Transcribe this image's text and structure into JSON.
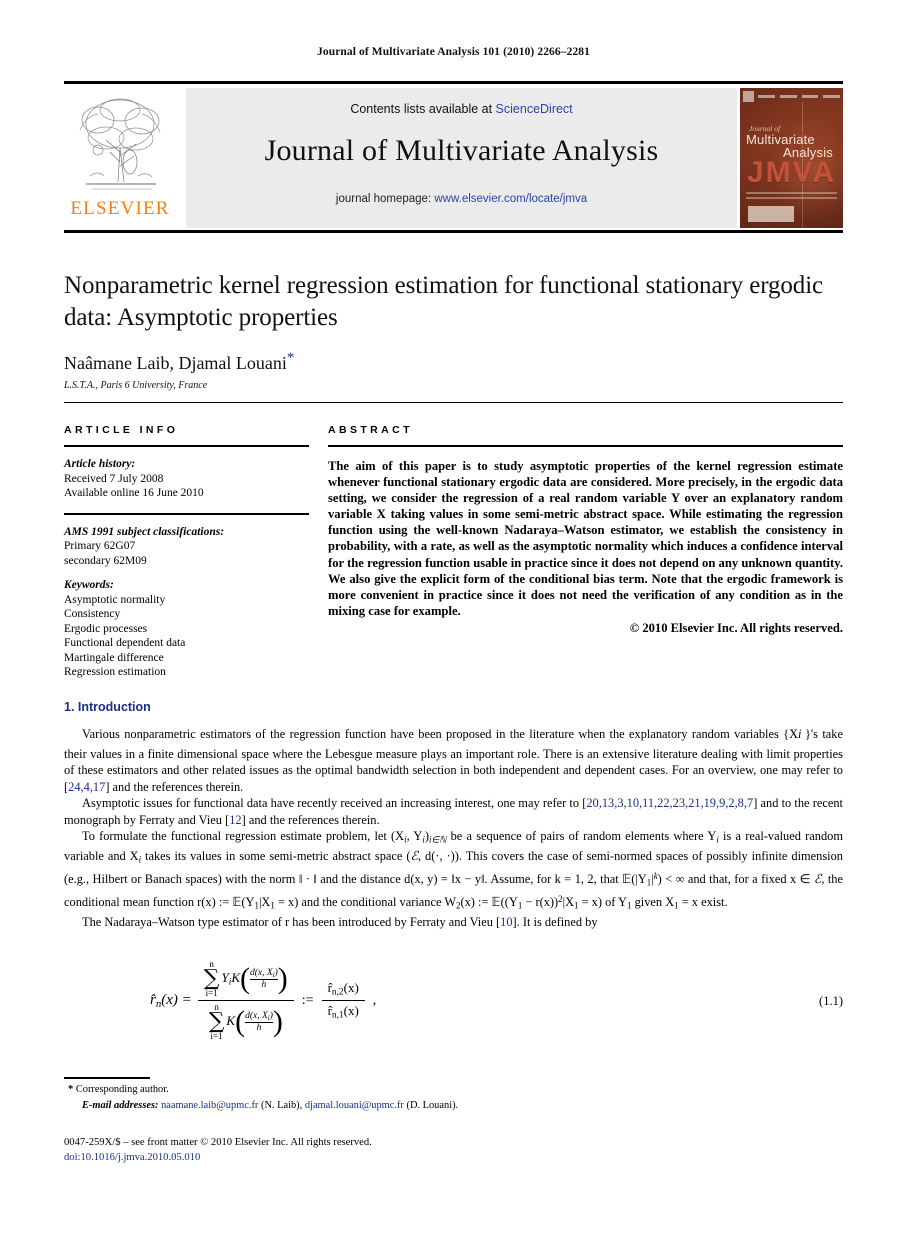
{
  "running_head": "Journal of Multivariate Analysis 101 (2010) 2266–2281",
  "masthead": {
    "contents_prefix": "Contents lists available at ",
    "contents_link": "ScienceDirect",
    "journal_title": "Journal of Multivariate Analysis",
    "homepage_prefix": "journal homepage: ",
    "homepage_url": "www.elsevier.com/locate/jmva",
    "publisher_wordmark": "ELSEVIER",
    "cover": {
      "journal_of": "Journal of",
      "name_line1": "Multivariate",
      "name_line2": "Analysis",
      "acronym": "JMVA"
    },
    "link_color": "#2b44a8",
    "publisher_color": "#F08010",
    "cover_color": "#6d2d1c"
  },
  "article": {
    "title": "Nonparametric kernel regression estimation for functional stationary ergodic data: Asymptotic properties",
    "authors": "Naâmane Laib, Djamal Louani",
    "corresponding_marker": "*",
    "affiliation": "L.S.T.A., Paris 6 University, France"
  },
  "info": {
    "label": "ARTICLE INFO",
    "history_head": "Article history:",
    "history_lines": [
      "Received 7 July 2008",
      "Available online 16 June 2010"
    ],
    "msc_head": "AMS 1991 subject classifications:",
    "msc_lines": [
      "Primary 62G07",
      "secondary 62M09"
    ],
    "keywords_head": "Keywords:",
    "keywords": [
      "Asymptotic normality",
      "Consistency",
      "Ergodic processes",
      "Functional dependent data",
      "Martingale difference",
      "Regression estimation"
    ]
  },
  "abstract": {
    "label": "ABSTRACT",
    "text": "The aim of this paper is to study asymptotic properties of the kernel regression estimate whenever functional stationary ergodic data are considered. More precisely, in the ergodic data setting, we consider the regression of a real random variable Y over an explanatory random variable X taking values in some semi-metric abstract space. While estimating the regression function using the well-known Nadaraya–Watson estimator, we establish the consistency in probability, with a rate, as well as the asymptotic normality which induces a confidence interval for the regression function usable in practice since it does not depend on any unknown quantity. We also give the explicit form of the conditional bias term. Note that the ergodic framework is more convenient in practice since it does not need the verification of any condition as in the mixing case for example.",
    "copyright": "© 2010 Elsevier Inc. All rights reserved."
  },
  "body": {
    "section_number_title": "1. Introduction",
    "p1_a": "Various nonparametric estimators of the regression function have been proposed in the literature when the explanatory random variables {X",
    "p1_b": "}'s take their values in a finite dimensional space where the Lebesgue measure plays an important role. There is an extensive literature dealing with limit properties of these estimators and other related issues as the optimal bandwidth selection in both independent and dependent cases. For an overview, one may refer to [",
    "p1_cit": "24,4,17",
    "p1_c": "] and the references therein.",
    "p2_a": "Asymptotic issues for functional data have recently received an increasing interest, one may refer to [",
    "p2_cit1": "20,13,3,10,11,22,23,21,19,9,2,8,7",
    "p2_b": "] and to the recent monograph by Ferraty and Vieu [",
    "p2_cit2": "12",
    "p2_c": "] and the references therein.",
    "p3_a": "To formulate the functional regression estimate problem, let (X",
    "p3_b": ", Y",
    "p3_c": ")",
    "p3_d": " be a sequence of pairs of random elements where Y",
    "p3_e": " is a real-valued random variable and X",
    "p3_f": " takes its values in some semi-metric abstract space (",
    "p3_g": ", d(·, ·)). This covers the case of semi-normed spaces of possibly infinite dimension (e.g., Hilbert or Banach spaces) with the norm ‖ · ‖ and the distance d(x, y) = ‖x − y‖. Assume, for k = 1, 2, that 𝔼(|Y",
    "p3_h": "|",
    "p3_i": ") < ∞ and that, for a fixed x ∈ ",
    "p3_j": ", the conditional mean function r(x) := 𝔼(Y",
    "p3_k": "|X",
    "p3_l": " = x) and the conditional variance W",
    "p3_m": "(x) := 𝔼((Y",
    "p3_n": " − r(x))",
    "p3_o": "|X",
    "p3_p": " = x) of Y",
    "p3_q": " given X",
    "p3_r": " = x exist.",
    "p4_a": "The Nadaraya–Watson type estimator of r has been introduced by Ferraty and Vieu [",
    "p4_cit": "10",
    "p4_b": "]. It is defined by"
  },
  "equation": {
    "lhs": "r̂",
    "lhs_sub": "n",
    "lhs_arg": "(x) =",
    "sum_upper": "n",
    "sum_lower": "i=1",
    "num_terms": "Y",
    "num_sub": "i",
    "num_kernel": "K",
    "kernel_num": "d(x, X",
    "kernel_num_sub": "i",
    "kernel_num_end": ")",
    "kernel_den": "h",
    "assign": ":=",
    "rhs_num": "r̂",
    "rhs_num_sub": "n,2",
    "rhs_num_arg": "(x)",
    "rhs_den": "r̂",
    "rhs_den_sub": "n,1",
    "rhs_den_arg": "(x)",
    "comma": ",",
    "tag": "(1.1)"
  },
  "footer": {
    "corresponding_star": "*",
    "corresponding_text": "Corresponding author.",
    "email_label": "E-mail addresses:",
    "email1": "naamane.laib@upmc.fr",
    "email1_who": "(N. Laib),",
    "email2": "djamal.louani@upmc.fr",
    "email2_who": "(D. Louani).",
    "front_matter": "0047-259X/$ – see front matter © 2010 Elsevier Inc. All rights reserved.",
    "doi": "doi:10.1016/j.jmva.2010.05.010"
  }
}
